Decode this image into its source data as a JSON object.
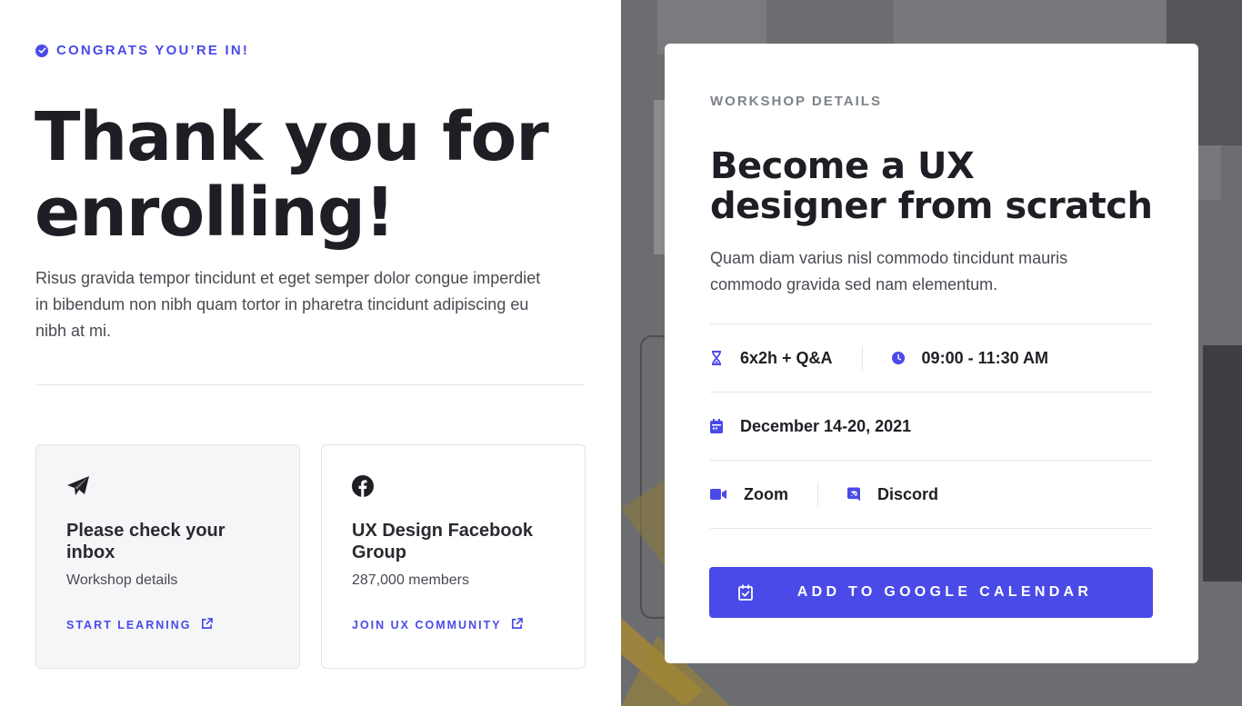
{
  "hero": {
    "eyebrow": "CONGRATS YOU’RE IN!",
    "title": "Thank you for enrolling!",
    "description": "Risus gravida tempor tincidunt et eget semper dolor congue imperdiet in bibendum non nibh quam tortor in pharetra tincidunt adipiscing eu nibh at mi."
  },
  "cards": [
    {
      "icon": "paper-plane-icon",
      "title": "Please check your inbox",
      "subtitle": "Workshop details",
      "link_label": "START LEARNING",
      "link_icon": "external-link-icon"
    },
    {
      "icon": "facebook-icon",
      "title": "UX Design Facebook Group",
      "subtitle": "287,000 members",
      "link_label": "JOIN UX COMMUNITY",
      "link_icon": "external-link-icon"
    }
  ],
  "workshop": {
    "eyebrow": "WORKSHOP DETAILS",
    "title": "Become a UX designer from scratch",
    "description": "Quam diam varius nisl commodo tincidunt mauris commodo gravida sed nam elementum.",
    "duration": "6x2h + Q&A",
    "time": "09:00 - 11:30 AM",
    "date": "December 14-20, 2021",
    "platform_video": "Zoom",
    "platform_chat": "Discord",
    "cta_label": "ADD TO GOOGLE CALENDAR"
  },
  "colors": {
    "accent": "#4a4ae8",
    "text_dark": "#1e1e24",
    "text_body": "#4a4a52",
    "eyebrow_gray": "#7d8388",
    "card_bg": "#f5f6f8",
    "overlay": "#6e6f72"
  }
}
